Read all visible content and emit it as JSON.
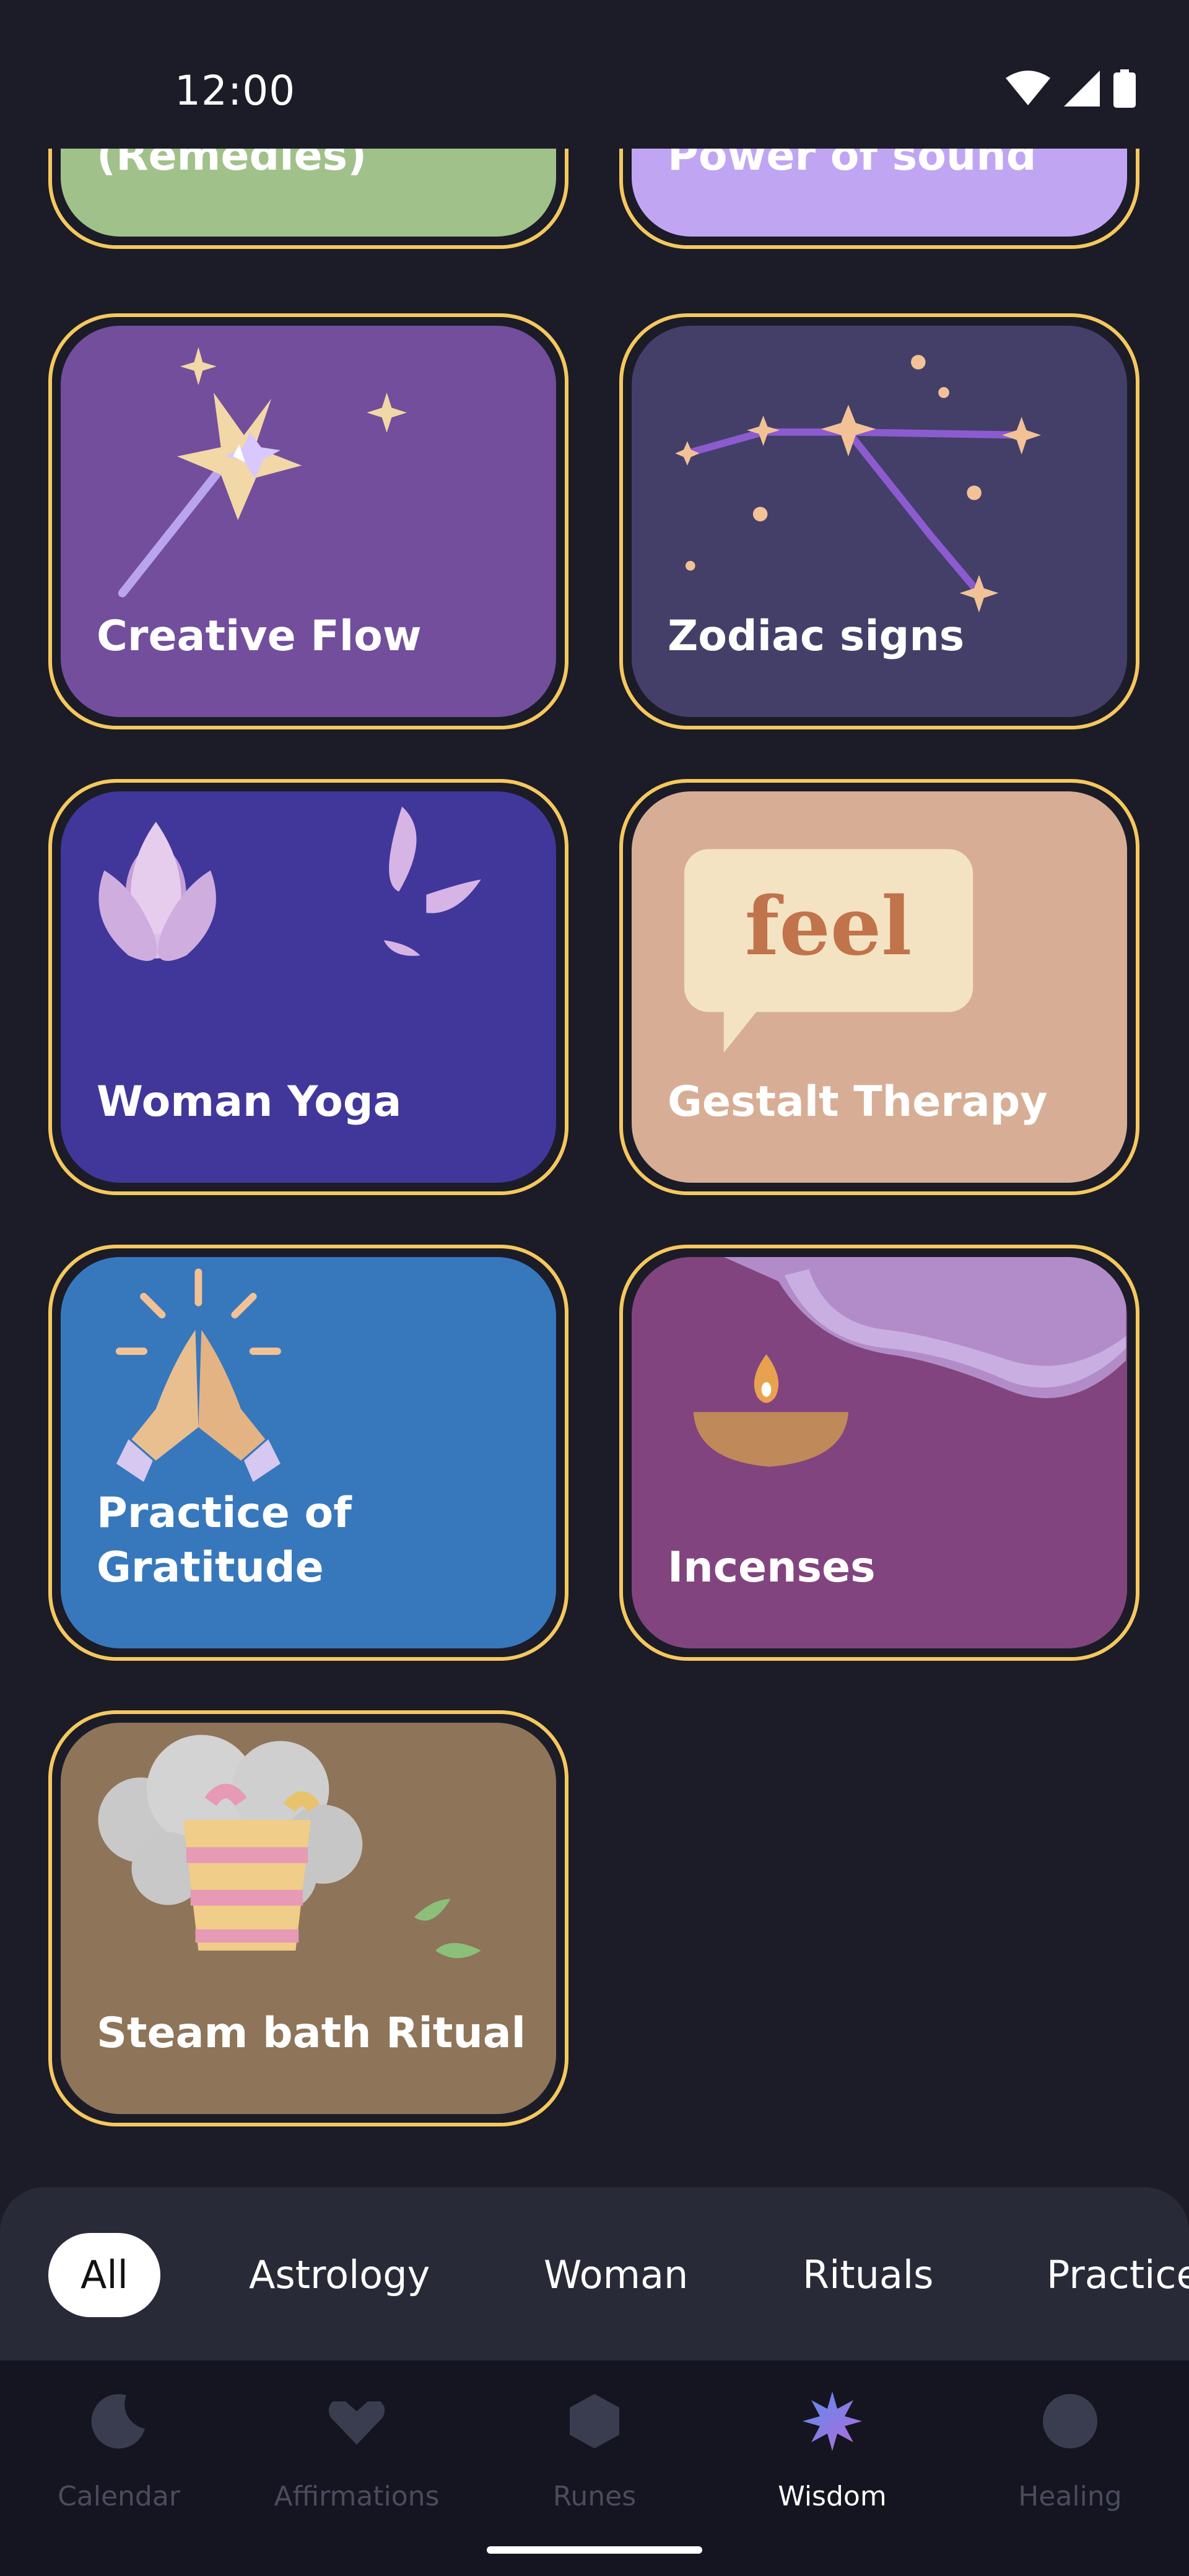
{
  "status_bar": {
    "time": "12:00"
  },
  "cards": [
    {
      "title": "(Remedies)",
      "bg": "#a1c18a"
    },
    {
      "title": "Power of sound",
      "bg": "#c0a6f2"
    },
    {
      "title": "Creative Flow",
      "bg": "#724e9c"
    },
    {
      "title": "Zodiac signs",
      "bg": "#433f69"
    },
    {
      "title": "Woman Yoga",
      "bg": "#41379a"
    },
    {
      "title": "Gestalt Therapy",
      "bg": "#d7ae95"
    },
    {
      "title": "Practice of Gratitude",
      "title_line1": "Practice of",
      "title_line2": "Gratitude",
      "bg": "#3778bd"
    },
    {
      "title": "Incenses",
      "bg": "#82447e"
    },
    {
      "title": "Steam bath Ritual",
      "bg": "#8e7459"
    }
  ],
  "art_text": {
    "feel": "feel"
  },
  "filters": [
    "All",
    "Astrology",
    "Woman",
    "Rituals",
    "Practice"
  ],
  "selected_filter": "All",
  "nav": [
    {
      "label": "Calendar",
      "icon": "moon-icon"
    },
    {
      "label": "Affirmations",
      "icon": "heart-icon"
    },
    {
      "label": "Runes",
      "icon": "hexagon-icon"
    },
    {
      "label": "Wisdom",
      "icon": "star-burst-icon",
      "active": true
    },
    {
      "label": "Healing",
      "icon": "circle-icon"
    }
  ],
  "colors": {
    "card_border": "#f5c85e",
    "background": "#1b1c27",
    "active_nav": "#ffffff"
  }
}
